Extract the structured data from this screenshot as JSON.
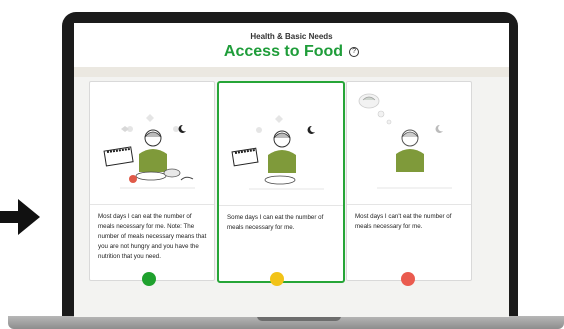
{
  "header": {
    "subtitle": "Health & Basic Needs",
    "title": "Access to Food",
    "help_icon": "?"
  },
  "cards": [
    {
      "text": "Most days I can eat the number of meals necessary for me. Note: The number of meals necessary means that you are not hungry and you have the nutrition that you need.",
      "status_color": "#1fa12e",
      "selected": false
    },
    {
      "text": "Some days I can eat the number of meals necessary for me.",
      "status_color": "#f2c318",
      "selected": true
    },
    {
      "text": "Most days I can't eat the number of meals necessary for me.",
      "status_color": "#ea5b4f",
      "selected": false
    }
  ],
  "colors": {
    "accent": "#26a537",
    "figure_shirt": "#7f9a3a"
  }
}
